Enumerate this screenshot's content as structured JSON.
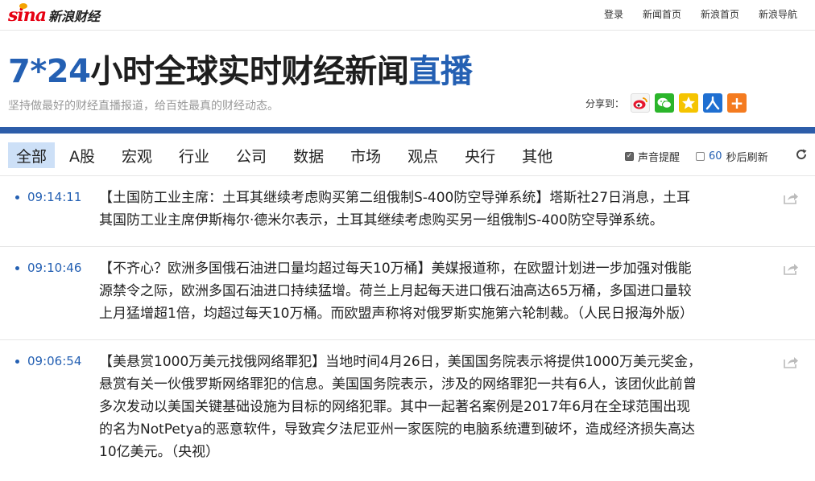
{
  "brand": {
    "logo_text": "sina",
    "name": "新浪财经"
  },
  "toplinks": [
    "登录",
    "新闻首页",
    "新浪首页",
    "新浪导航"
  ],
  "headline": {
    "part1": "7*24",
    "part2": "小时全球实时财经新闻",
    "part3": "直播"
  },
  "subtitle": "坚持做最好的财经直播报道，给百姓最真的财经动态。",
  "share": {
    "label": "分享到：",
    "more_symbol": "+"
  },
  "tabs": [
    "全部",
    "A股",
    "宏观",
    "行业",
    "公司",
    "数据",
    "市场",
    "观点",
    "央行",
    "其他"
  ],
  "active_tab": "全部",
  "options": {
    "sound_label": "声音提醒",
    "sound_checked": true,
    "refresh_seconds": "60",
    "refresh_label": "秒后刷新",
    "refresh_checked": false
  },
  "news": [
    {
      "time": "09:14:11",
      "lines": [
        "【土国防工业主席：土耳其继续考虑购买第二组俄制S-400防空导弹系统】塔斯社27日消息，土耳",
        "其国防工业主席伊斯梅尔·德米尔表示，土耳其继续考虑购买另一组俄制S-400防空导弹系统。"
      ]
    },
    {
      "time": "09:10:46",
      "lines": [
        "【不齐心？欧洲多国俄石油进口量均超过每天10万桶】美媒报道称，在欧盟计划进一步加强对俄能",
        "源禁令之际，欧洲多国石油进口持续猛增。荷兰上月起每天进口俄石油高达65万桶，多国进口量较",
        "上月猛增超1倍，均超过每天10万桶。而欧盟声称将对俄罗斯实施第六轮制裁。（人民日报海外版）"
      ]
    },
    {
      "time": "09:06:54",
      "lines": [
        "【美悬赏1000万美元找俄网络罪犯】当地时间4月26日，美国国务院表示将提供1000万美元奖金，",
        "悬赏有关一伙俄罗斯网络罪犯的信息。美国国务院表示，涉及的网络罪犯一共有6人，该团伙此前曾",
        "多次发动以美国关键基础设施为目标的网络犯罪。其中一起著名案例是2017年6月在全球范围出现",
        "的名为NotPetya的恶意软件，导致宾夕法尼亚州一家医院的电脑系统遭到破坏，造成经济损失高达",
        "10亿美元。（央视）"
      ]
    }
  ],
  "colors": {
    "accent": "#2460b3",
    "bar": "#2d5da9",
    "active_tab_bg": "#cde0f7"
  }
}
